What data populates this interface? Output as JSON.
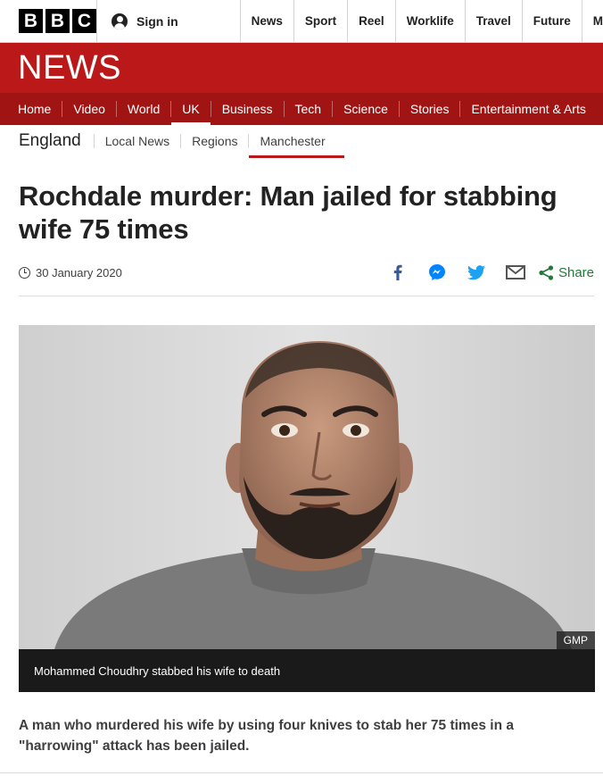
{
  "brand": {
    "logo_letters": [
      "B",
      "B",
      "C"
    ],
    "signin_label": "Sign in"
  },
  "top_nav": [
    "News",
    "Sport",
    "Reel",
    "Worklife",
    "Travel",
    "Future",
    "M"
  ],
  "masthead": {
    "title": "NEWS",
    "color": "#bb1919"
  },
  "section_nav": [
    {
      "label": "Home"
    },
    {
      "label": "Video"
    },
    {
      "label": "World"
    },
    {
      "label": "UK",
      "active": true
    },
    {
      "label": "Business"
    },
    {
      "label": "Tech"
    },
    {
      "label": "Science"
    },
    {
      "label": "Stories"
    },
    {
      "label": "Entertainment & Arts"
    }
  ],
  "sub_nav": {
    "section": "England",
    "items": [
      {
        "label": "Local News"
      },
      {
        "label": "Regions"
      },
      {
        "label": "Manchester",
        "active": true
      }
    ]
  },
  "article": {
    "headline": "Rochdale murder: Man jailed for stabbing wife 75 times",
    "date": "30 January 2020",
    "share_label": "Share",
    "share_icons": [
      "facebook-icon",
      "messenger-icon",
      "twitter-icon",
      "email-icon",
      "share-icon"
    ],
    "image": {
      "credit": "GMP",
      "caption": "Mohammed Choudhry stabbed his wife to death"
    },
    "intro": "A man who murdered his wife by using four knives to stab her 75 times in a \"harrowing\" attack has been jailed."
  },
  "colors": {
    "brand_red": "#bb1919",
    "nav_red": "#a01414",
    "share_green": "#1e7b38",
    "facebook": "#3b5998",
    "messenger": "#0084ff",
    "twitter": "#1da1f2"
  }
}
